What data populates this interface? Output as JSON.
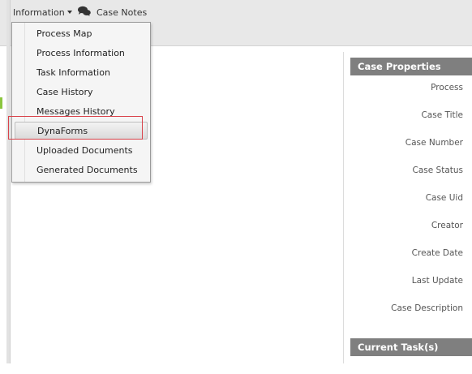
{
  "toolbar": {
    "information_label": "Information",
    "case_notes_label": "Case Notes"
  },
  "dropdown": {
    "items": [
      {
        "label": "Process Map"
      },
      {
        "label": "Process Information"
      },
      {
        "label": "Task Information"
      },
      {
        "label": "Case History"
      },
      {
        "label": "Messages History"
      },
      {
        "label": "DynaForms",
        "selected": true
      },
      {
        "label": "Uploaded Documents"
      },
      {
        "label": "Generated Documents"
      }
    ]
  },
  "case_properties": {
    "title": "Case Properties",
    "fields": [
      "Process",
      "Case Title",
      "Case Number",
      "Case Status",
      "Case Uid",
      "Creator",
      "Create Date",
      "Last Update",
      "Case Description"
    ]
  },
  "current_task_properties": {
    "title": "Current Task(s) Properties"
  },
  "colors": {
    "toolbar_bg": "#e8e8e8",
    "menu_bg": "#f5f5f5",
    "header_bg": "#7f7f7f",
    "highlight_border": "#d9434b"
  },
  "icons": [
    "chat-bubbles-icon",
    "chevron-down-icon"
  ]
}
